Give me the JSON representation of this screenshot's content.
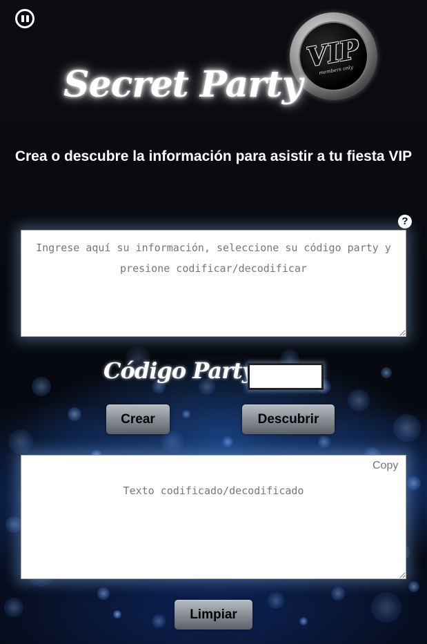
{
  "app": {
    "title": "Secret Party",
    "subtitle": "Crea o descubre la información para asistir a tu fiesta VIP"
  },
  "logo": {
    "text": "VIP",
    "subtext": "members only"
  },
  "controls": {
    "pause_icon": "pause-circle-icon",
    "help_icon_glyph": "?"
  },
  "input": {
    "placeholder": "Ingrese aquí su información, seleccione su código party y presione codificar/decodificar",
    "value": ""
  },
  "code": {
    "label": "Código Party :",
    "value": ""
  },
  "buttons": {
    "crear": "Crear",
    "descubrir": "Descubrir",
    "limpiar": "Limpiar"
  },
  "output": {
    "copy_label": "Copy",
    "placeholder": "Texto codificado/decodificado",
    "value": ""
  },
  "colors": {
    "background": "#05070d",
    "glow": "#96c8ff",
    "button": "#8d9398"
  }
}
